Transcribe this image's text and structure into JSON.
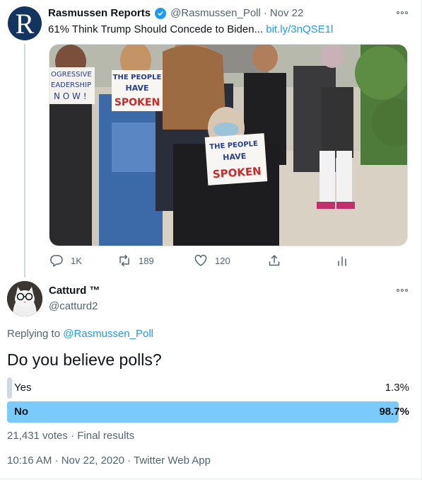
{
  "parent_tweet": {
    "avatar_letter": "R",
    "author_name": "Rasmussen Reports",
    "handle": "@Rasmussen_Poll",
    "separator": "·",
    "date": "Nov 22",
    "text": "61% Think Trump Should Concede to Biden...",
    "link": "bit.ly/3nQSE1l",
    "photo_signs": {
      "left_sign_lines": [
        "OGRESSIVE",
        "EADERSHIP",
        "N O W !"
      ],
      "center_sign_lines": [
        "THE PEOPLE",
        "HAVE",
        "SPOKEN"
      ],
      "front_sign_lines": [
        "THE PEOPLE",
        "HAVE",
        "SPOKEN"
      ]
    },
    "actions": {
      "reply_count": "1K",
      "retweet_count": "189",
      "like_count": "120"
    }
  },
  "reply_tweet": {
    "author_name": "Catturd ™",
    "handle": "@catturd2",
    "replying_prefix": "Replying to",
    "replying_handle": "@Rasmussen_Poll",
    "question": "Do you believe polls?",
    "poll": {
      "options": [
        {
          "label": "Yes",
          "percent_text": "1.3%",
          "percent": 1.3,
          "winner": false
        },
        {
          "label": "No",
          "percent_text": "98.7%",
          "percent": 98.7,
          "winner": true
        }
      ],
      "votes_text": "21,431 votes",
      "separator": "·",
      "status_text": "Final results"
    },
    "timestamp": "10:16 AM · Nov 22, 2020 · Twitter Web App"
  },
  "colors": {
    "accent": "#1d9bf0",
    "poll_winner": "#7acbfb",
    "poll_loser": "#cfd9de",
    "secondary_text": "#536471",
    "brand_navy": "#12345e"
  },
  "icons": [
    "verified-badge-icon",
    "more-options-icon",
    "reply-icon",
    "retweet-icon",
    "like-icon",
    "share-icon",
    "analytics-icon"
  ]
}
